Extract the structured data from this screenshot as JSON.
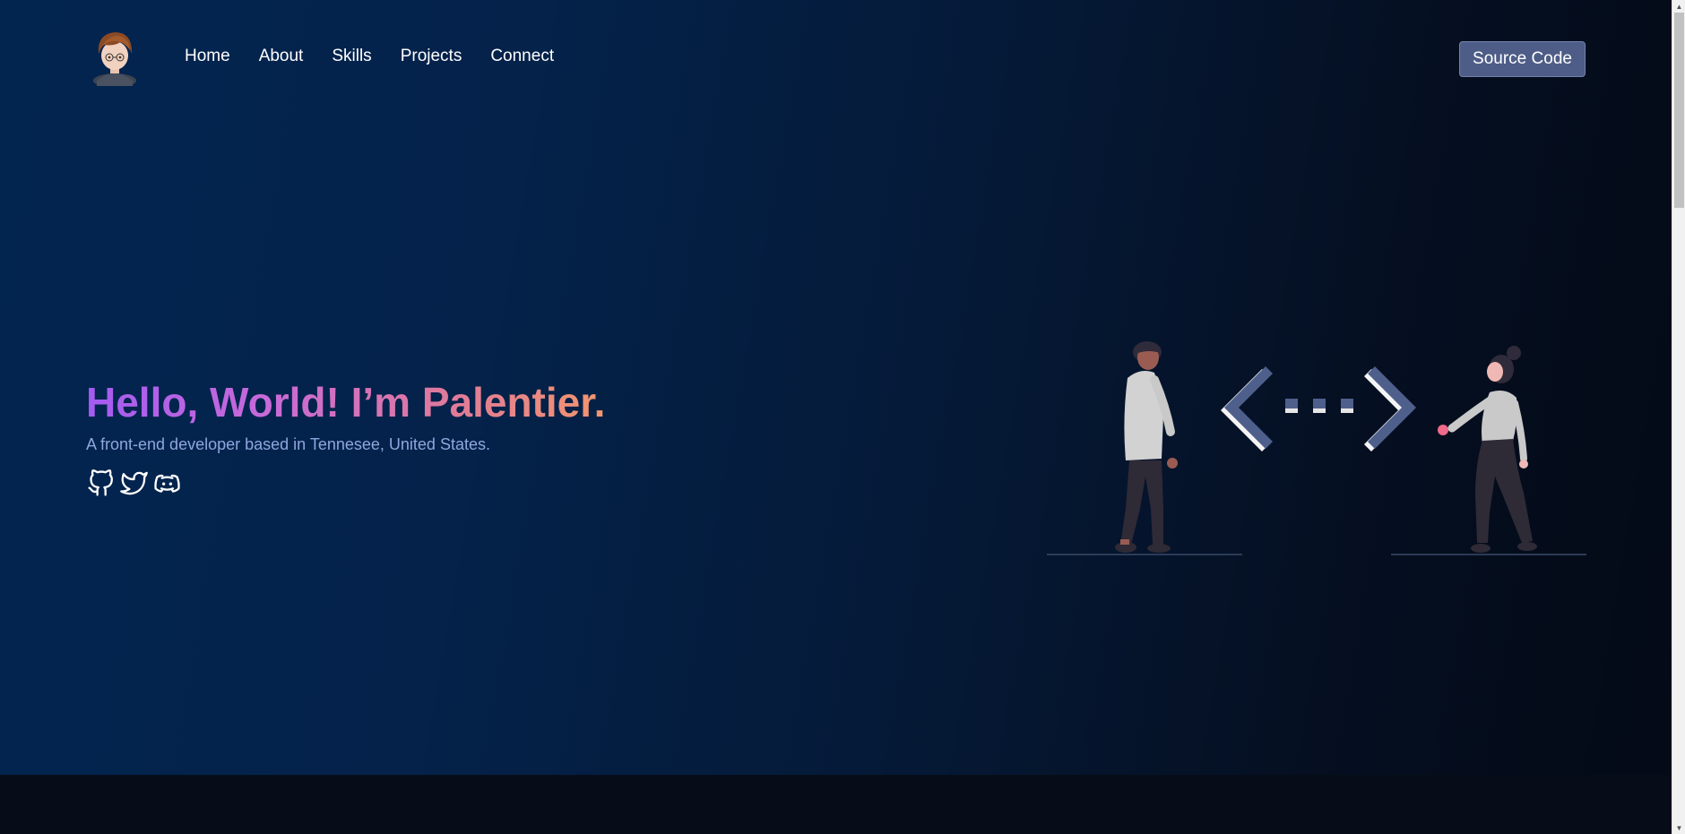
{
  "nav": {
    "items": [
      "Home",
      "About",
      "Skills",
      "Projects",
      "Connect"
    ],
    "source_label": "Source Code"
  },
  "hero": {
    "headline": "Hello, World! I’m Palentier.",
    "subtitle": "A front-end developer based in Tennesee, United States.",
    "socials": [
      "github-icon",
      "twitter-icon",
      "discord-icon"
    ]
  },
  "colors": {
    "accent_button": "#4e5d87",
    "subtitle": "#8fa6de",
    "gradient_start": "#a35bf1",
    "gradient_end": "#f2966e",
    "illustration_code": "#4e5f8c"
  }
}
